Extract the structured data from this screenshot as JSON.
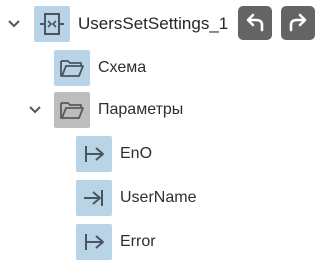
{
  "tree": {
    "root": {
      "label": "UsersSetSettings_1",
      "icon": "function-block-icon",
      "expanded": true
    },
    "items": [
      {
        "label": "Схема",
        "icon": "folder-icon"
      },
      {
        "label": "Параметры",
        "icon": "folder-icon",
        "expanded": true,
        "children": [
          {
            "label": "EnO",
            "icon": "output-parameter-icon"
          },
          {
            "label": "UserName",
            "icon": "input-parameter-icon"
          },
          {
            "label": "Error",
            "icon": "output-parameter-icon"
          }
        ]
      }
    ]
  },
  "toolbar": {
    "undo_icon": "undo-icon",
    "redo_icon": "redo-icon"
  },
  "colors": {
    "tile_blue": "#b8d4e6",
    "tile_gray": "#bdbdbd",
    "button_bg": "#646464",
    "icon_stroke": "#4a5560"
  }
}
